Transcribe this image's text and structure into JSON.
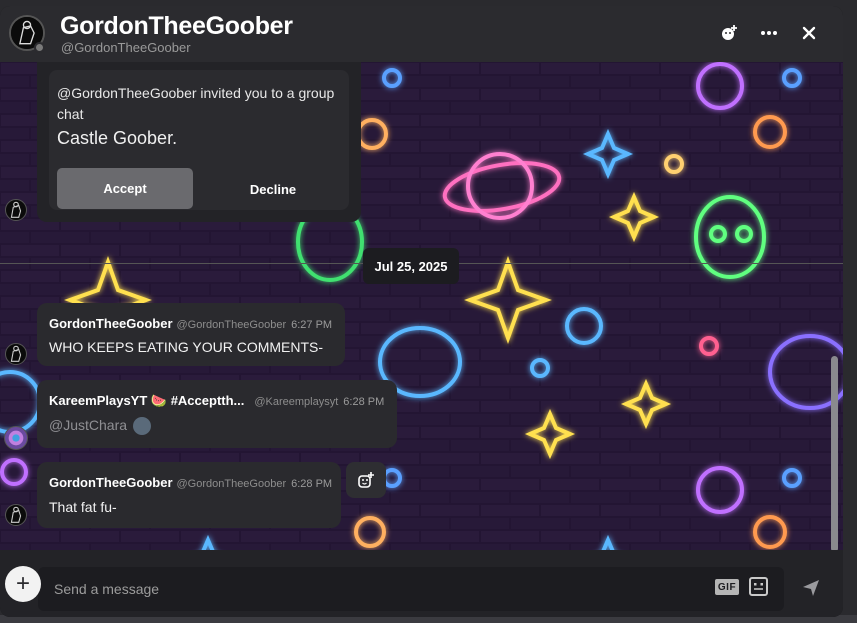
{
  "header": {
    "title": "GordonTheeGoober",
    "handle": "@GordonTheeGoober",
    "icons": [
      "add-friend-icon",
      "more-icon",
      "close-icon"
    ]
  },
  "invite": {
    "text": "@GordonTheeGoober invited you to a group chat",
    "group_name": "Castle Goober.",
    "accept_label": "Accept",
    "decline_label": "Decline"
  },
  "date_divider": "Jul 25, 2025",
  "messages": [
    {
      "name": "GordonTheeGoober",
      "handle": "@GordonTheeGoober",
      "time": "6:27 PM",
      "text": "WHO KEEPS EATING YOUR COMMENTS-"
    },
    {
      "name": "KareemPlaysYT 🍉 #Acceptth...",
      "handle": "@Kareemplaysyt",
      "time": "6:28 PM",
      "text": "@JustChara"
    },
    {
      "name": "GordonTheeGoober",
      "handle": "@GordonTheeGoober",
      "time": "6:28 PM",
      "text": "That fat fu-"
    }
  ],
  "composer": {
    "placeholder": "Send a message",
    "gif_label": "GIF"
  },
  "colors": {
    "header_bg": "#2b2b2f",
    "message_bg": "#2a2a2e",
    "accept_bg": "#6a6a6e"
  }
}
